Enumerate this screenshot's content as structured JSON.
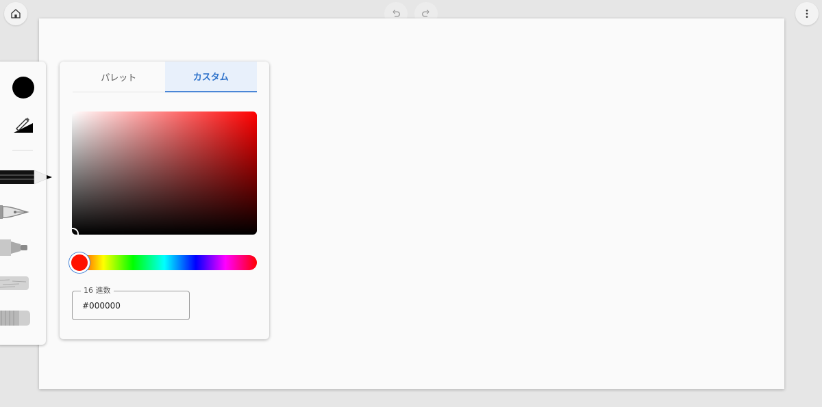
{
  "tabs": [
    {
      "label": "パレット",
      "active": false
    },
    {
      "label": "カスタム",
      "active": true
    }
  ],
  "picker": {
    "hue_color": "#ff0000",
    "thumb_color": "#ff1200"
  },
  "hex": {
    "label": "16 進数",
    "value": "#000000"
  },
  "current_color": "#000000",
  "accent_color": "#2a6fc9",
  "icons": {
    "home": "home-icon",
    "undo": "undo-icon",
    "redo": "redo-icon",
    "menu": "more-vert-icon"
  }
}
